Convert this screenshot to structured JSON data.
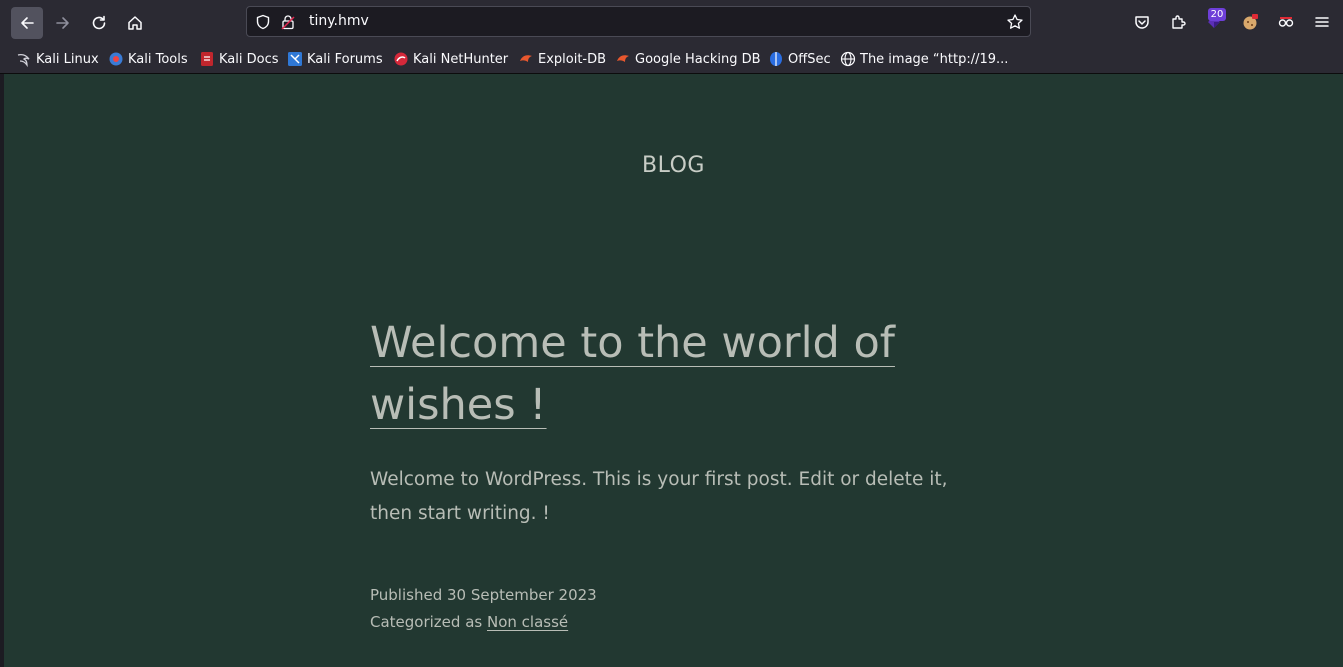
{
  "browser": {
    "url": "tiny.hmv",
    "extension_badge": "20"
  },
  "bookmarks": [
    {
      "label": "Kali Linux",
      "icon": "kali-dragon-icon"
    },
    {
      "label": "Kali Tools",
      "icon": "kali-tools-icon"
    },
    {
      "label": "Kali Docs",
      "icon": "kali-docs-icon"
    },
    {
      "label": "Kali Forums",
      "icon": "kali-forums-icon"
    },
    {
      "label": "Kali NetHunter",
      "icon": "kali-nethunter-icon"
    },
    {
      "label": "Exploit-DB",
      "icon": "exploit-db-icon"
    },
    {
      "label": "Google Hacking DB",
      "icon": "ghdb-icon"
    },
    {
      "label": "OffSec",
      "icon": "offsec-icon"
    },
    {
      "label": "The image “http://19...",
      "icon": "globe-icon"
    }
  ],
  "page": {
    "site_title": "BLOG",
    "post_title": "Welcome to the world of wishes !",
    "post_excerpt": "Welcome to WordPress. This is your first post. Edit or delete it, then start writing. !",
    "published_label": "Published",
    "published_date": "30 September 2023",
    "category_label": "Categorized as",
    "category": "Non classé"
  },
  "colors": {
    "page_background": "#223831",
    "toolbar_background": "#2b2a33",
    "text": "#b8bdb6"
  }
}
